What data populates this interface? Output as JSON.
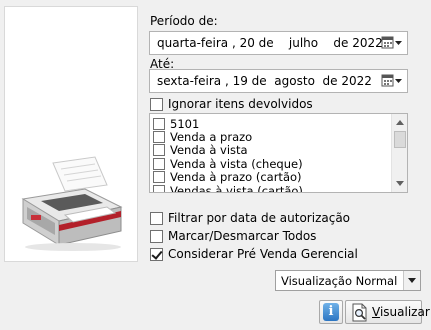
{
  "form": {
    "period_label": "Período de:",
    "from_date_text": "quarta-feira , 20 de    julho    de 2022",
    "until_label": "Até:",
    "to_date_text": "sexta-feira , 19 de  agosto  de 2022",
    "ignore_returned_label": "Ignorar itens devolvidos",
    "payment_types": [
      {
        "label": "5101",
        "checked": false
      },
      {
        "label": "Venda a prazo",
        "checked": false
      },
      {
        "label": "Venda à vista",
        "checked": false
      },
      {
        "label": "Venda à vista (cheque)",
        "checked": false
      },
      {
        "label": "Venda à prazo (cartão)",
        "checked": false
      },
      {
        "label": "Vendas à vista (cartão)",
        "checked": false
      }
    ],
    "filter_auth_date_label": "Filtrar por data de autorização",
    "toggle_all_label": "Marcar/Desmarcar Todos",
    "pre_sale_label": "Considerar Pré Venda Gerencial",
    "checkboxes": {
      "ignore_returned": false,
      "filter_auth_date": false,
      "toggle_all": false,
      "pre_sale": true
    }
  },
  "view_mode": {
    "selected": "Visualização Normal"
  },
  "buttons": {
    "info_glyph": "i",
    "view_first_letter": "V",
    "view_rest": "isualizar"
  },
  "icons": {
    "printer": "printer-icon",
    "calendar": "calendar-icon",
    "info": "info-icon",
    "preview": "document-preview-icon"
  }
}
